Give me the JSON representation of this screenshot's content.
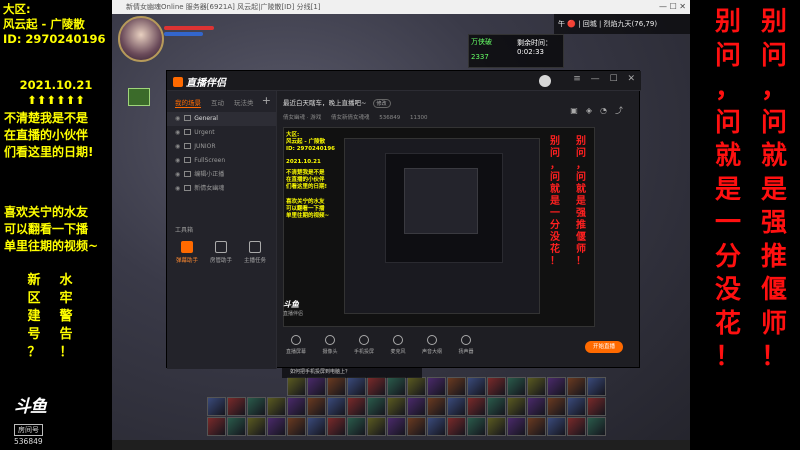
{
  "left_panel": {
    "region_label": "大区:",
    "region_name": "风云起 - 广陵散",
    "room_id": "ID: 2970240196",
    "date": "2021.10.21",
    "arrows": "⬆⬆⬆⬆⬆⬆",
    "question_lines": [
      "不清楚我是不是",
      "在直播的小伙伴",
      "们看这里的日期!"
    ],
    "friends_lines": [
      "喜欢关宁的水友",
      "可以翻看一下播",
      "单里往期的视频~"
    ],
    "col1_chars": [
      "新",
      "区",
      "建",
      "号",
      "？"
    ],
    "col2_chars": [
      "水",
      "牢",
      "警",
      "告",
      "！"
    ],
    "logo_text": "斗鱼",
    "logo_tag": "房间号",
    "logo_room": "536849"
  },
  "red_overlay": {
    "col1": [
      "别",
      "问",
      "，",
      "问",
      "就",
      "是",
      "一",
      "分",
      "没",
      "花",
      "！"
    ],
    "col2": [
      "别",
      "问",
      "，",
      "问",
      "就",
      "是",
      "强",
      "推",
      "偃",
      "师",
      "！"
    ]
  },
  "game": {
    "window_title": "新倩女幽魂Online 服务器[6921A] 风云起|广陵散[ID] 分线[1]",
    "hud_top_right": "午  🔴 | 回城 | 烈焰九天(76,79)",
    "minimap_title": "万侠破",
    "minimap_time": "剩余时间：0:02:33",
    "minimap_score": "2337"
  },
  "stream_app": {
    "logo": "直播伴侣",
    "tabs": [
      "我的场景",
      "互动",
      "玩法类"
    ],
    "scenes": [
      "General",
      "Urgent",
      "JUNIOR",
      "FullScreen",
      "编辑小正播",
      "新倩女幽魂"
    ],
    "toolbox_label": "工具箱",
    "tools": [
      "弹幕助手",
      "房管助手",
      "主播任务"
    ],
    "room_title": "最近白天瞎车，晚上直播吧~",
    "room_tag": "修改",
    "room_info": [
      "倩女幽魂 · 游戏",
      "倩女新倩女魂魂",
      "536849",
      "11300"
    ],
    "controls": [
      "直播屏幕",
      "摄像头",
      "手机投屏",
      "麦克风",
      "声音大纲",
      "扬声器"
    ],
    "live_button": "开始直播",
    "bottom_logo": "斗鱼",
    "bottom_logo_tag": "直播伴侣"
  },
  "nested": {
    "text_lines": [
      "大区:",
      "风云起 - 广陵散",
      "ID: 2970240196",
      "2021.10.21",
      "不清楚我是不是",
      "在直播的小伙伴",
      "们看这里的日期!",
      "喜欢关宁的水友",
      "可以翻看一下播",
      "单里往期的视频~"
    ],
    "red1": [
      "别",
      "问",
      "，",
      "问",
      "就",
      "是",
      "一",
      "分",
      "没",
      "花",
      "！"
    ],
    "red2": [
      "别",
      "问",
      "，",
      "问",
      "就",
      "是",
      "强",
      "推",
      "偃",
      "师",
      "！"
    ]
  },
  "status_bar": {
    "text": "如何把手机投屏到电脑上？"
  }
}
